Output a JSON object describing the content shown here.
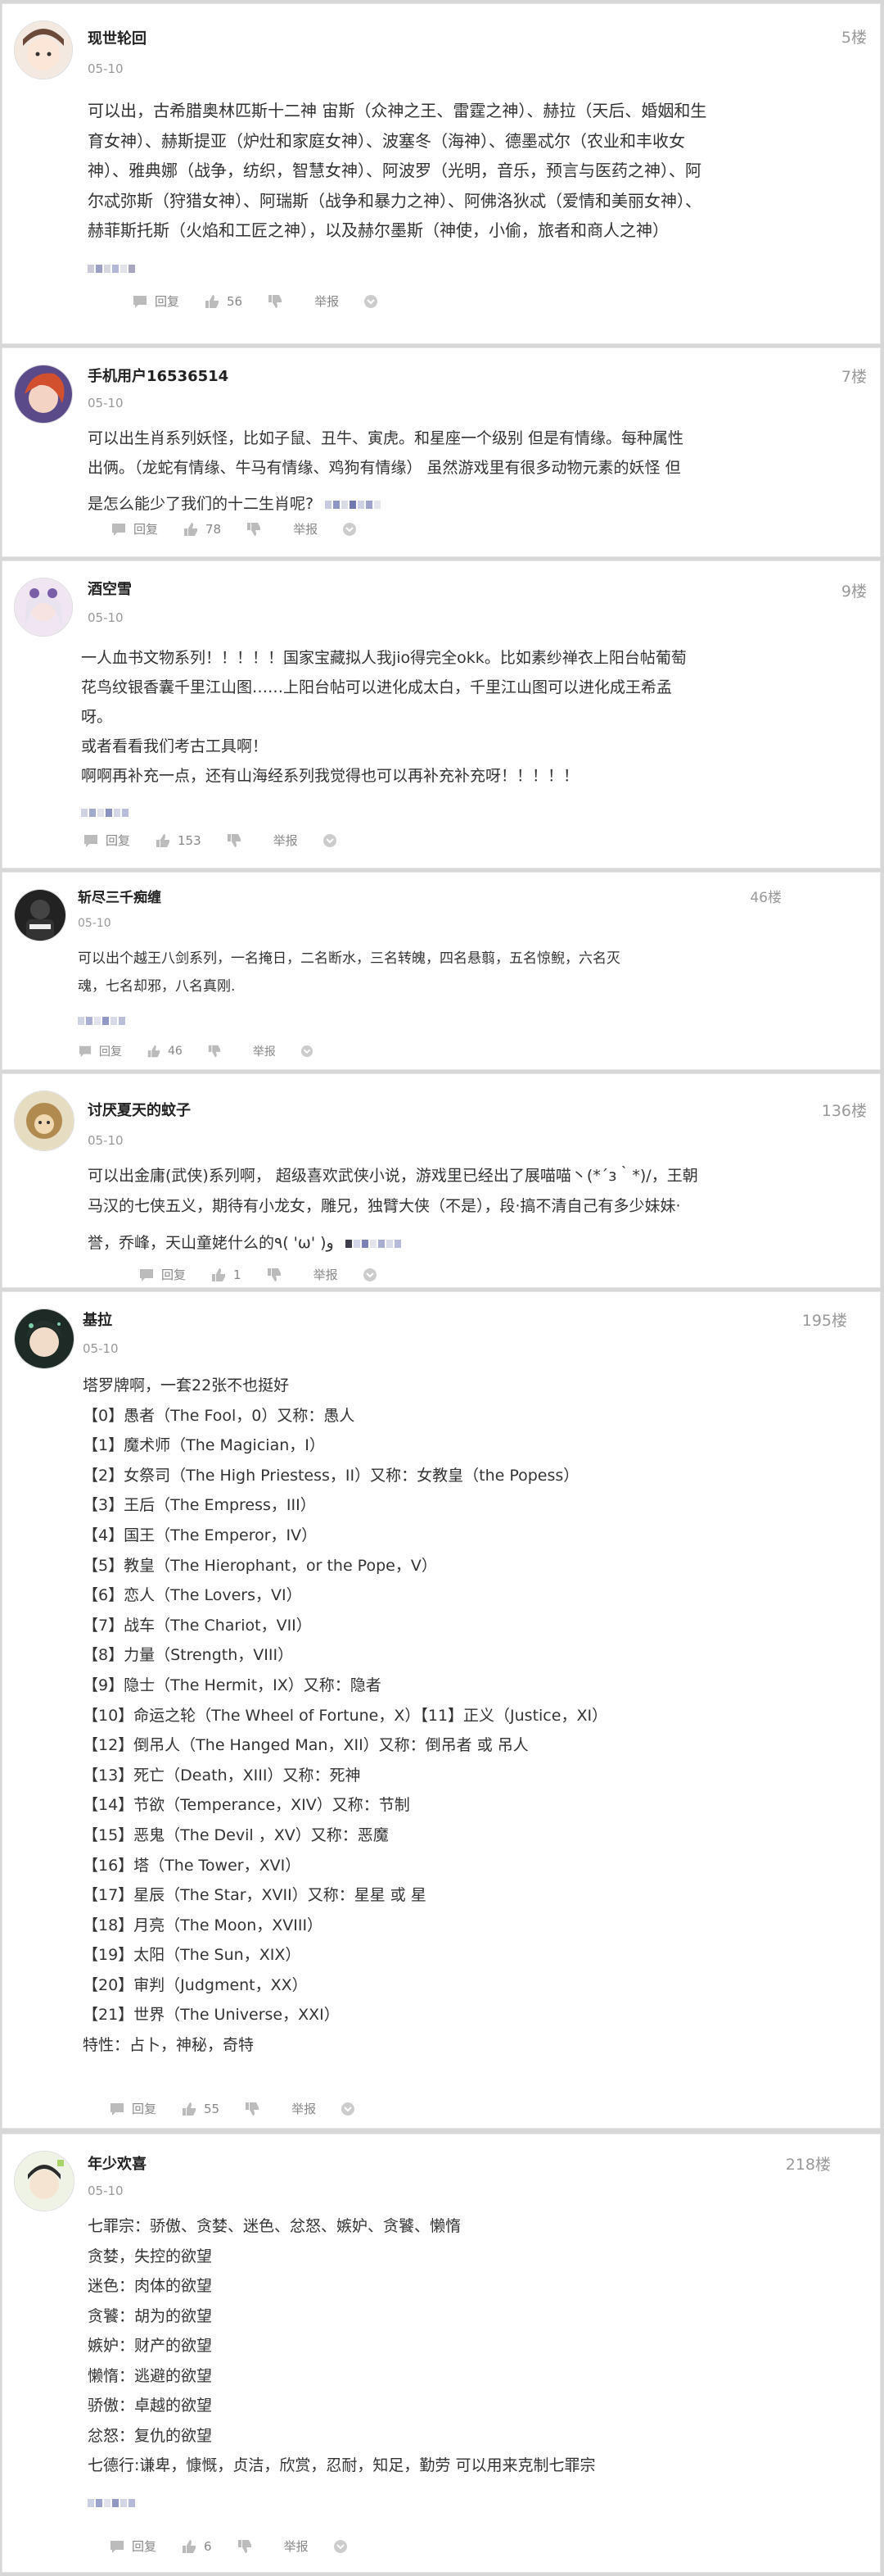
{
  "colors": {
    "background": "#d7d7d7",
    "card": "#ffffff",
    "meta": "#999999",
    "text": "#333333"
  },
  "labels": {
    "reply": "回复",
    "report": "举报"
  },
  "comments": [
    {
      "username": "现世轮回",
      "date": "05-10",
      "floor": "5楼",
      "likes": "56",
      "lines": [
        "可以出，古希腊奥林匹斯十二神 宙斯（众神之王、雷霆之神）、赫拉（天后、婚姻和生",
        "育女神）、赫斯提亚（炉灶和家庭女神）、波塞冬（海神）、德墨忒尔（农业和丰收女",
        "神）、雅典娜（战争，纺织，智慧女神）、阿波罗（光明，音乐，预言与医药之神）、阿",
        "尔忒弥斯（狩猎女神）、阿瑞斯（战争和暴力之神）、阿佛洛狄忒（爱情和美丽女神）、",
        "赫菲斯托斯（火焰和工匠之神），以及赫尔墨斯（神使，小偷，旅者和商人之神）"
      ]
    },
    {
      "username": "手机用户16536514",
      "date": "05-10",
      "floor": "7楼",
      "likes": "78",
      "lines": [
        "可以出生肖系列妖怪，比如子鼠、丑牛、寅虎。和星座一个级别 但是有情缘。每种属性",
        "出俩。（龙蛇有情缘、牛马有情缘、鸡狗有情缘） 虽然游戏里有很多动物元素的妖怪 但",
        "是怎么能少了我们的十二生肖呢?"
      ]
    },
    {
      "username": "酒空雪",
      "date": "05-10",
      "floor": "9楼",
      "likes": "153",
      "lines": [
        "一人血书文物系列！！！！！国家宝藏拟人我jio得完全okk。比如素纱禅衣上阳台帖葡萄",
        "花鸟纹银香囊千里江山图……上阳台帖可以进化成太白，千里江山图可以进化成王希孟",
        "呀。",
        "或者看看我们考古工具啊！",
        "啊啊再补充一点，还有山海经系列我觉得也可以再补充补充呀！！！！！"
      ]
    },
    {
      "username": "斩尽三千痴缠",
      "date": "05-10",
      "floor": "46楼",
      "likes": "46",
      "lines": [
        "可以出个越王八剑系列，一名掩日，二名断水，三名转魄，四名悬翦，五名惊鲵，六名灭",
        "魂，七名却邪，八名真刚."
      ]
    },
    {
      "username": "讨厌夏天的蚊子",
      "date": "05-10",
      "floor": "136楼",
      "likes": "1",
      "lines": [
        "可以出金庸(武侠)系列啊， 超级喜欢武侠小说，游戏里已经出了展喵喵丶(*´з｀*)/，王朝",
        "马汉的七侠五义，期待有小龙女，雕兄，独臂大侠（不是），段·搞不清自己有多少妹妹·",
        "誉，乔峰，天山童姥什么的٩( 'ω' )و"
      ]
    },
    {
      "username": "基拉",
      "date": "05-10",
      "floor": "195楼",
      "likes": "55",
      "lines": [
        "塔罗牌啊，一套22张不也挺好",
        "【0】愚者（The Fool，0）又称：愚人",
        "【1】魔术师（The Magician，I）",
        "【2】女祭司（The High Priestess，II）又称：女教皇（the Popess）",
        "【3】王后（The Empress，III）",
        "【4】国王（The Emperor，IV）",
        "【5】教皇（The Hierophant，or the Pope，V）",
        "【6】恋人（The Lovers，VI）",
        "【7】战车（The Chariot，VII）",
        "【8】力量（Strength，VIII）",
        "【9】隐士（The Hermit，IX）又称：隐者",
        "【10】命运之轮（The Wheel of Fortune，X）【11】正义（Justice，XI）",
        "【12】倒吊人（The Hanged Man，XII）又称：倒吊者 或 吊人",
        "【13】死亡（Death，XIII）又称：死神",
        "【14】节欲（Temperance，XIV）又称：节制",
        "【15】恶鬼（The Devil ，XV）又称：恶魔",
        "【16】塔（The Tower，XVI）",
        "【17】星辰（The Star，XVII）又称：星星 或 星",
        "【18】月亮（The Moon，XVIII）",
        "【19】太阳（The Sun，XIX）",
        "【20】审判（Judgment，XX）",
        "【21】世界（The Universe，XXI）",
        "特性：占卜，神秘，奇特"
      ]
    },
    {
      "username": "年少欢喜",
      "date": "05-10",
      "floor": "218楼",
      "likes": "6",
      "lines": [
        "七罪宗：骄傲、贪婪、迷色、忿怒、嫉妒、贪饕、懒惰",
        "贪婪，失控的欲望",
        "迷色：肉体的欲望",
        "贪饕：胡为的欲望",
        "嫉妒：财产的欲望",
        "懒惰：逃避的欲望",
        "骄傲：卓越的欲望",
        "忿怒：复仇的欲望",
        "七德行:谦卑，慷慨，贞洁，欣赏，忍耐，知足，勤劳 可以用来克制七罪宗"
      ]
    }
  ]
}
